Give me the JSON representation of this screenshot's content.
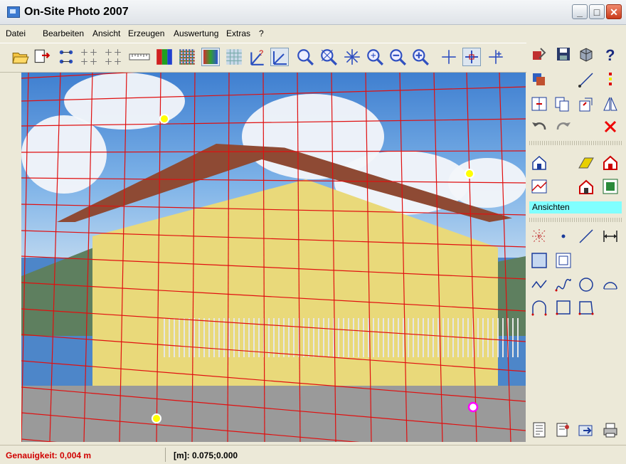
{
  "window": {
    "title": "On-Site Photo 2007"
  },
  "menu": [
    "Datei",
    "Bearbeiten",
    "Ansicht",
    "Erzeugen",
    "Auswertung",
    "Extras",
    "?"
  ],
  "window_buttons": {
    "minimize": "_",
    "maximize": "□",
    "close": "✕"
  },
  "toolbar": {
    "icons": [
      "open-folder-icon",
      "import-icon",
      "points-grid-icon",
      "points-grid-2-icon",
      "points-grid-3-icon",
      "ruler-icon",
      "rgb-bars-icon",
      "color-grid-icon",
      "gradient-icon",
      "mesh-icon",
      "angle-help-icon",
      "angle-icon",
      "zoom-point-icon",
      "zoom-cross-icon",
      "star-icon",
      "zoom-fit-icon",
      "zoom-out-icon",
      "zoom-in-icon",
      "cross-icon",
      "cross-bold-icon",
      "cross-offset-icon"
    ]
  },
  "panel": {
    "section_label": "Ansichten"
  },
  "status": {
    "accuracy": "Genauigkeit: 0,004 m",
    "coordinates": "[m]: 0.075;0.000"
  },
  "colors": {
    "grid": "#e01010",
    "marker": "#ffff00",
    "marker_selected": "#ff00ff",
    "status_red": "#d00000",
    "label_bg": "#80ffff"
  }
}
